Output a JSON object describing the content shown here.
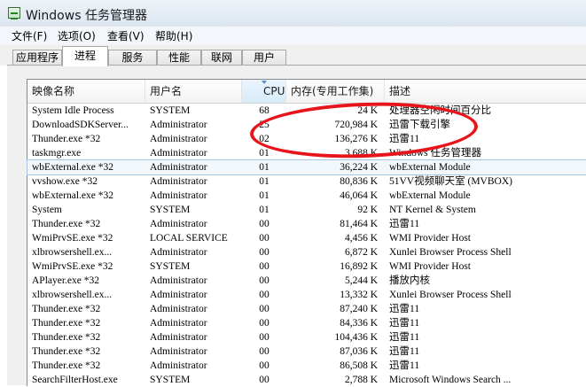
{
  "window": {
    "title": "Windows 任务管理器"
  },
  "menu": [
    "文件(F)",
    "选项(O)",
    "查看(V)",
    "帮助(H)"
  ],
  "tabs": [
    {
      "label": "应用程序",
      "active": false
    },
    {
      "label": "进程",
      "active": true
    },
    {
      "label": "服务",
      "active": false
    },
    {
      "label": "性能",
      "active": false
    },
    {
      "label": "联网",
      "active": false
    },
    {
      "label": "用户",
      "active": false
    }
  ],
  "columns": {
    "name": "映像名称",
    "user": "用户名",
    "cpu": "CPU",
    "memory": "内存(专用工作集)",
    "description": "描述"
  },
  "processes": [
    [
      "System Idle Process",
      "SYSTEM",
      "68",
      "24 K",
      "处理器空闲时间百分比"
    ],
    [
      "DownloadSDKServer...",
      "Administrator",
      "25",
      "720,984 K",
      "迅雷下载引擎"
    ],
    [
      "Thunder.exe *32",
      "Administrator",
      "02",
      "136,276 K",
      "迅雷11"
    ],
    [
      "taskmgr.exe",
      "Administrator",
      "01",
      "3,688 K",
      "Windows 任务管理器"
    ],
    [
      "wbExternal.exe *32",
      "Administrator",
      "01",
      "36,224 K",
      "wbExternal Module"
    ],
    [
      "vvshow.exe *32",
      "Administrator",
      "01",
      "80,836 K",
      "51VV视频聊天室 (MVBOX)"
    ],
    [
      "wbExternal.exe *32",
      "Administrator",
      "01",
      "46,064 K",
      "wbExternal Module"
    ],
    [
      "System",
      "SYSTEM",
      "01",
      "92 K",
      "NT Kernel & System"
    ],
    [
      "Thunder.exe *32",
      "Administrator",
      "00",
      "81,464 K",
      "迅雷11"
    ],
    [
      "WmiPrvSE.exe *32",
      "LOCAL SERVICE",
      "00",
      "4,456 K",
      "WMI Provider Host"
    ],
    [
      "xlbrowsershell.ex...",
      "Administrator",
      "00",
      "6,872 K",
      "Xunlei Browser Process Shell"
    ],
    [
      "WmiPrvSE.exe *32",
      "SYSTEM",
      "00",
      "16,892 K",
      "WMI Provider Host"
    ],
    [
      "APlayer.exe *32",
      "Administrator",
      "00",
      "5,244 K",
      "播放内核"
    ],
    [
      "xlbrowsershell.ex...",
      "Administrator",
      "00",
      "13,332 K",
      "Xunlei Browser Process Shell"
    ],
    [
      "Thunder.exe *32",
      "Administrator",
      "00",
      "87,240 K",
      "迅雷11"
    ],
    [
      "Thunder.exe *32",
      "Administrator",
      "00",
      "84,336 K",
      "迅雷11"
    ],
    [
      "Thunder.exe *32",
      "Administrator",
      "00",
      "104,436 K",
      "迅雷11"
    ],
    [
      "Thunder.exe *32",
      "Administrator",
      "00",
      "87,036 K",
      "迅雷11"
    ],
    [
      "Thunder.exe *32",
      "Administrator",
      "00",
      "86,508 K",
      "迅雷11"
    ],
    [
      "SearchFilterHost.exe",
      "SYSTEM",
      "00",
      "2,788 K",
      "Microsoft Windows Search ..."
    ]
  ],
  "selected_row_index": 4,
  "annotation": {
    "color": "#e8141c",
    "shape": "ellipse"
  }
}
